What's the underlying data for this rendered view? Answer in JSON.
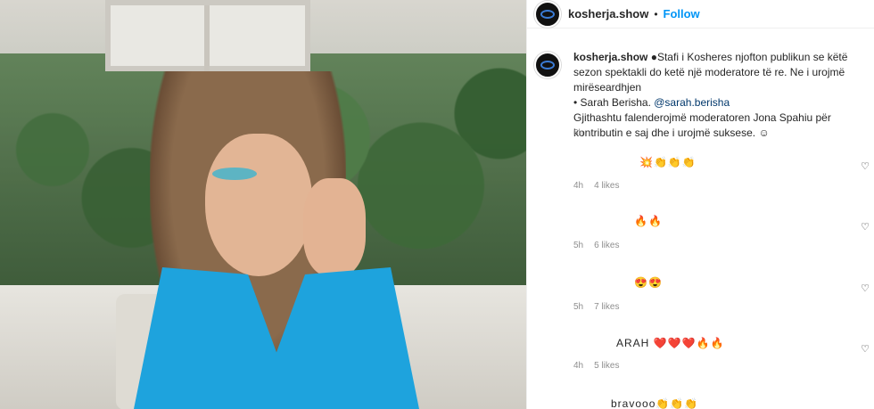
{
  "post": {
    "username": "kosherja.show",
    "follow_label": "Follow",
    "separator": "•"
  },
  "caption": {
    "username": "kosherja.show",
    "line1": "●Stafi i Kosheres njofton publikun se këtë sezon spektakli do ketë një moderatore të re. Ne i urojmë mirëseardhjen",
    "line2": "• Sarah Berisha. ",
    "mention": "@sarah.berisha",
    "line3": "Gjithashtu falenderojmë moderatoren Jona Spahiu për kontributin e saj dhe i urojmë suksese. ☺",
    "time": "6h"
  },
  "comments": [
    {
      "text": "💥👏👏👏",
      "time": "4h",
      "likes": "4 likes"
    },
    {
      "text": "🔥🔥",
      "time": "5h",
      "likes": "6 likes"
    },
    {
      "text": "😍😍",
      "time": "5h",
      "likes": "7 likes"
    },
    {
      "text": "ARAH ❤️❤️❤️🔥🔥",
      "time": "4h",
      "likes": "5 likes"
    },
    {
      "text": "bravooo👏👏👏",
      "time": "",
      "likes": ""
    }
  ],
  "icons": {
    "heart": "heart-icon"
  }
}
